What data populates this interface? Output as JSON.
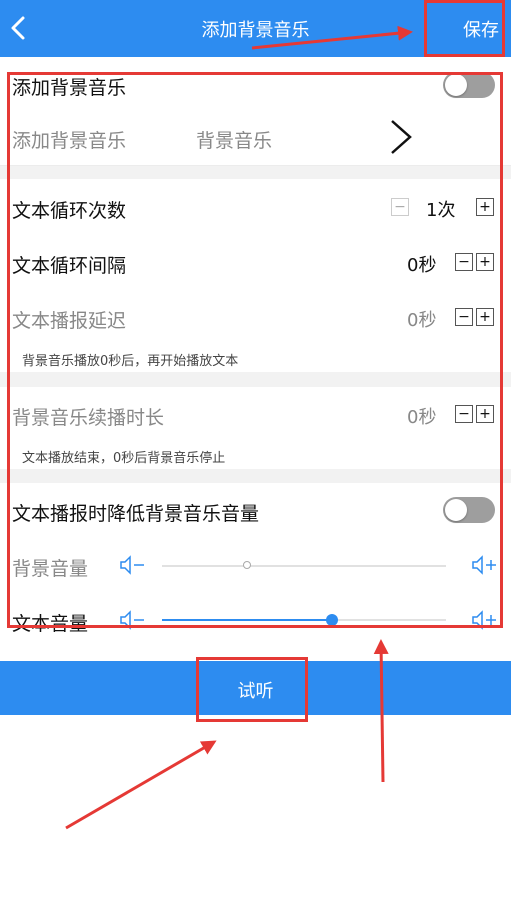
{
  "header": {
    "title": "添加背景音乐",
    "save_label": "保存"
  },
  "settings": {
    "add_music_toggle_label": "添加背景音乐",
    "add_music_toggle_on": false,
    "select_music_label": "添加背景音乐",
    "select_music_value": "背景音乐",
    "loop_count_label": "文本循环次数",
    "loop_count_value": "1次",
    "loop_interval_label": "文本循环间隔",
    "loop_interval_value": "0秒",
    "delay_label": "文本播报延迟",
    "delay_value": "0秒",
    "delay_note": "背景音乐播放0秒后，再开始播放文本",
    "continue_label": "背景音乐续播时长",
    "continue_value": "0秒",
    "continue_note": "文本播放结束，0秒后背景音乐停止",
    "duck_label": "文本播报时降低背景音乐音量",
    "duck_on": false,
    "bg_volume_label": "背景音量",
    "bg_volume_level": 0.3,
    "text_volume_label": "文本音量",
    "text_volume_level": 0.6,
    "minus_glyph": "−",
    "plus_glyph": "+"
  },
  "footer": {
    "listen_label": "试听"
  },
  "colors": {
    "accent": "#2d8cf0",
    "annotation": "#e53935"
  }
}
